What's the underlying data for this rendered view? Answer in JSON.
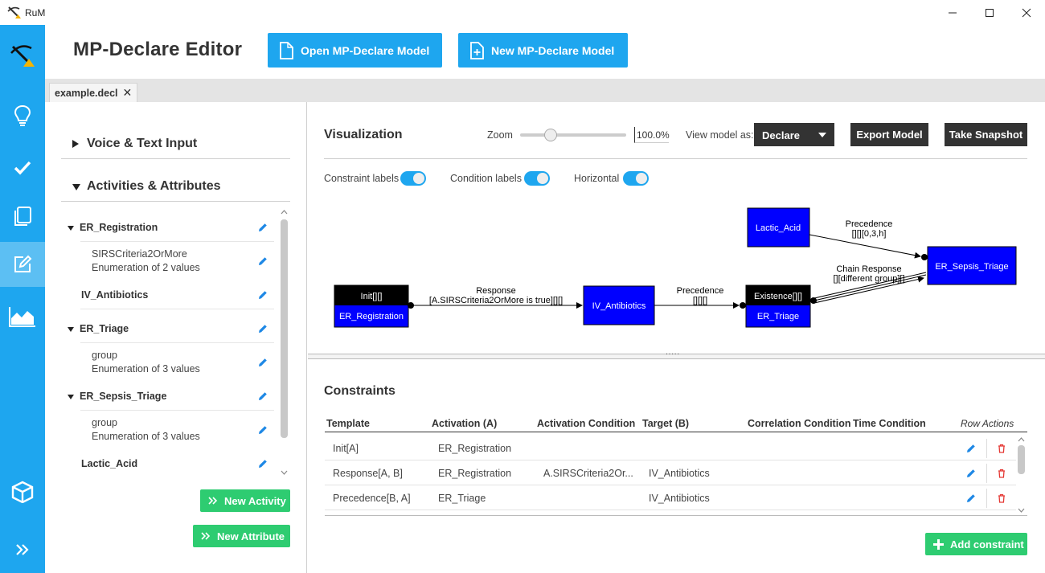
{
  "window": {
    "title": "RuM"
  },
  "header": {
    "title": "MP-Declare Editor",
    "open_label": "Open MP-Declare Model",
    "new_label": "New MP-Declare Model"
  },
  "tabs": [
    {
      "label": "example.decl"
    }
  ],
  "left": {
    "voice_section": "Voice & Text Input",
    "activities_section": "Activities & Attributes",
    "items": [
      {
        "name": "ER_Registration"
      },
      {
        "attr": "SIRSCriteria2OrMore",
        "desc": "Enumeration of 2 values"
      },
      {
        "name": "IV_Antibiotics"
      },
      {
        "name": "ER_Triage"
      },
      {
        "attr": "group",
        "desc": "Enumeration of 3 values"
      },
      {
        "name": "ER_Sepsis_Triage"
      },
      {
        "attr": "group",
        "desc": "Enumeration of 3 values"
      },
      {
        "name": "Lactic_Acid"
      }
    ],
    "new_activity": "New Activity",
    "new_attribute": "New Attribute"
  },
  "visualization": {
    "title": "Visualization",
    "zoom_label": "Zoom",
    "zoom_value": "100.0%",
    "zoom_fraction": 0.26,
    "view_as_label": "View model as:",
    "view_as_value": "Declare",
    "export_label": "Export Model",
    "snapshot_label": "Take Snapshot",
    "toggles": {
      "constraint_labels": "Constraint labels",
      "condition_labels": "Condition labels",
      "horizontal": "Horizontal"
    },
    "graph": {
      "init_top": "Init[][]",
      "init_bottom": "ER_Registration",
      "iv": "IV_Antibiotics",
      "exist_top": "Existence[][]",
      "exist_bottom": "ER_Triage",
      "lactic": "Lactic_Acid",
      "sepsis": "ER_Sepsis_Triage",
      "response_l1": "Response",
      "response_l2": "[A.SIRSCriteria2OrMore is true][][]",
      "prec1_l1": "Precedence",
      "prec1_l2": "[][][]",
      "prec2_l1": "Precedence",
      "prec2_l2": "[][][0,3,h]",
      "chain_l1": "Chain Response",
      "chain_l2": "[][different group][]"
    },
    "splitter_grip": "....."
  },
  "constraints": {
    "title": "Constraints",
    "columns": [
      "Template",
      "Activation (A)",
      "Activation Condition",
      "Target (B)",
      "Correlation Condition",
      "Time Condition",
      "Row Actions"
    ],
    "rows": [
      {
        "template": "Init[A]",
        "activation": "ER_Registration",
        "act_cond": "",
        "target": ""
      },
      {
        "template": "Response[A, B]",
        "activation": "ER_Registration",
        "act_cond": "A.SIRSCriteria2Or...",
        "target": "IV_Antibiotics"
      },
      {
        "template": "Precedence[B, A]",
        "activation": "ER_Triage",
        "act_cond": "",
        "target": "IV_Antibiotics"
      }
    ],
    "add_label": "Add constraint"
  },
  "colors": {
    "accent": "#1ea6ef",
    "green": "#2ecc71",
    "node_blue": "#0000ff",
    "dark": "#333333",
    "delete_red": "#e53935"
  }
}
